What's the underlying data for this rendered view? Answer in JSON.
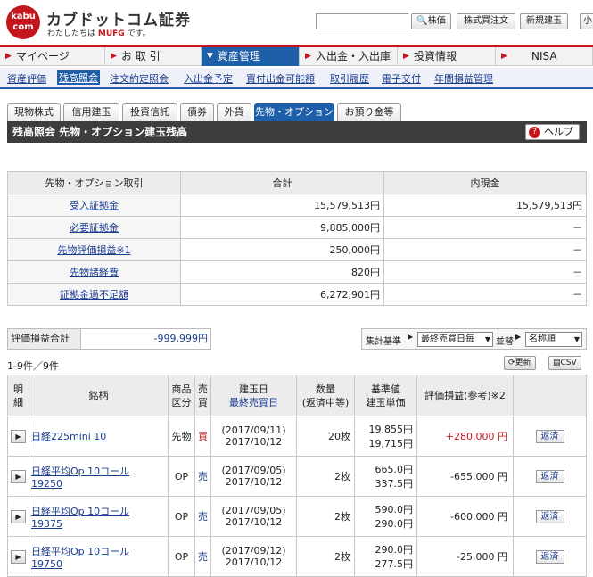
{
  "header": {
    "logo_top": "kabu",
    "logo_bottom": "com",
    "brand": "カブドットコム証券",
    "tagline_prefix": "わたしたちは",
    "tagline_mufg": "MUFG",
    "tagline_suffix": "です。",
    "buttons": {
      "stock_price": "株価",
      "stock_order": "株式買注文",
      "new_build": "新規建玉",
      "small": "小"
    }
  },
  "global_nav": [
    "マイページ",
    "お 取 引",
    "資産管理",
    "入出金・入出庫",
    "投資情報",
    "NISA"
  ],
  "sub_nav": [
    "資産評価",
    "残高照会",
    "注文約定照会",
    "入出金予定",
    "買付出金可能額",
    "取引履歴",
    "電子交付",
    "年間損益管理"
  ],
  "tabs": [
    "現物株式",
    "信用建玉",
    "投資信託",
    "債券",
    "外貨",
    "先物・オプション",
    "お預り金等"
  ],
  "title": "残高照会 先物・オプション建玉残高",
  "help": "ヘルプ",
  "summary": {
    "headers": [
      "先物・オプション取引",
      "合計",
      "内現金"
    ],
    "rows": [
      {
        "label": "受入証拠金",
        "total": "15,579,513円",
        "cash": "15,579,513円"
      },
      {
        "label": "必要証拠金",
        "total": "9,885,000円",
        "cash": "－"
      },
      {
        "label": "先物評価損益※1",
        "total": "250,000円",
        "cash": "－"
      },
      {
        "label": "先物諸経費",
        "total": "820円",
        "cash": "－"
      },
      {
        "label": "証拠金過不足額",
        "total": "6,272,901円",
        "cash": "－"
      }
    ]
  },
  "eval": {
    "label": "評価損益合計",
    "value": "-999,999円"
  },
  "controls": {
    "sum_label": "集計基準",
    "sum_value": "最終売買日毎",
    "sort_label": "並替",
    "sort_value": "名称順"
  },
  "count": "1-9件／9件",
  "refresh": "更新",
  "csv": "CSV",
  "positions": {
    "headers": {
      "detail": [
        "明",
        "細"
      ],
      "name": "銘柄",
      "product": [
        "商品",
        "区分"
      ],
      "side": [
        "売",
        "買"
      ],
      "date": [
        "建玉日",
        "最終売買日"
      ],
      "qty": [
        "数量",
        "(返済中等)"
      ],
      "price": [
        "基準値",
        "建玉単価"
      ],
      "pl": "評価損益(参考)※2"
    },
    "rows": [
      {
        "name": [
          "日経225mini 10"
        ],
        "product": "先物",
        "side": "買",
        "date": "(2017/09/11)",
        "last": "2017/10/12",
        "qty": "20枚",
        "base": "19,855円",
        "unit": "19,715円",
        "pl": "+280,000 円",
        "repay": "返済"
      },
      {
        "name": [
          "日経平均Op 10コール",
          "19250"
        ],
        "product": "OP",
        "side": "売",
        "date": "(2017/09/05)",
        "last": "2017/10/12",
        "qty": "2枚",
        "base": "665.0円",
        "unit": "337.5円",
        "pl": "-655,000 円",
        "repay": "返済"
      },
      {
        "name": [
          "日経平均Op 10コール",
          "19375"
        ],
        "product": "OP",
        "side": "売",
        "date": "(2017/09/05)",
        "last": "2017/10/12",
        "qty": "2枚",
        "base": "590.0円",
        "unit": "290.0円",
        "pl": "-600,000 円",
        "repay": "返済"
      },
      {
        "name": [
          "日経平均Op 10コール",
          "19750"
        ],
        "product": "OP",
        "side": "売",
        "date": "(2017/09/12)",
        "last": "2017/10/12",
        "qty": "2枚",
        "base": "290.0円",
        "unit": "277.5円",
        "pl": "-25,000 円",
        "repay": "返済"
      }
    ]
  }
}
